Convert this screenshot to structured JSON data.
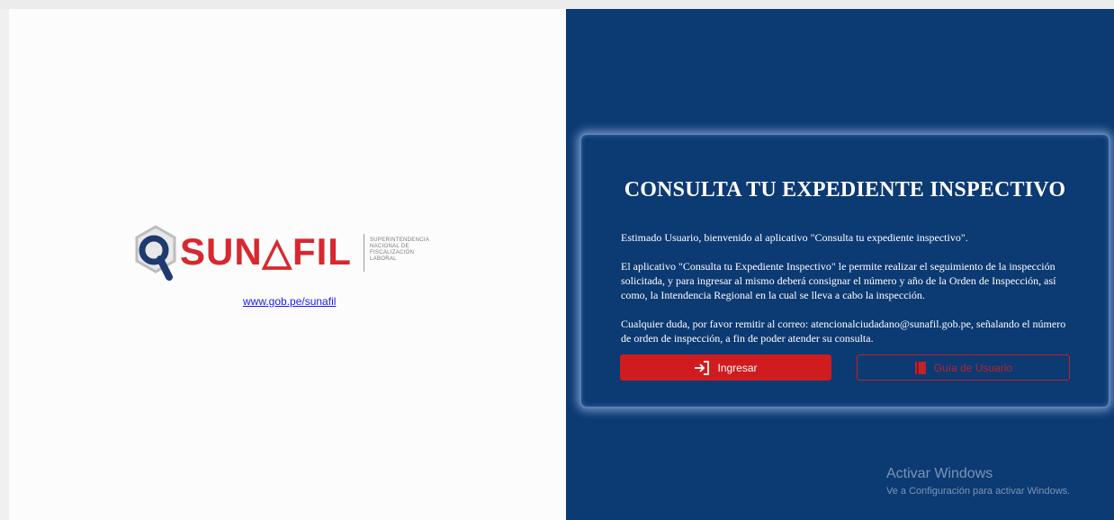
{
  "branding": {
    "logo_text": "SUN△FIL",
    "subtitle_lines": [
      "SUPERINTENDENCIA",
      "NACIONAL DE",
      "FISCALIZACIÓN",
      "LABORAL"
    ],
    "link_text": "www.gob.pe/sunafil",
    "brand_red": "#d7282f",
    "brand_navy": "#1e3a6e"
  },
  "card": {
    "title": "CONSULTA TU EXPEDIENTE INSPECTIVO",
    "paragraph_1": "Estimado Usuario, bienvenido al aplicativo \"Consulta tu expediente inspectivo\".",
    "paragraph_2": "El aplicativo \"Consulta tu Expediente Inspectivo\" le permite realizar el seguimiento de la inspección solicitada, y para ingresar al mismo deberá consignar el número y año de la Orden de Inspección, así como, la Intendencia Regional en la cual se lleva a cabo la inspección.",
    "paragraph_3": "Cualquier duda, por favor remitir al correo: atencionalciudadano@sunafil.gob.pe, señalando el número de orden de inspección, a fin de poder atender su consulta."
  },
  "buttons": {
    "ingresar_label": "Ingresar",
    "ingresar_icon": "login-icon",
    "guia_label": "Guía de Usuario",
    "guia_icon": "book-icon"
  },
  "watermark": {
    "title": "Activar Windows",
    "subtitle": "Ve a Configuración para activar Windows."
  },
  "colors": {
    "panel_blue": "#0c3a73",
    "button_red": "#d01c1f"
  }
}
